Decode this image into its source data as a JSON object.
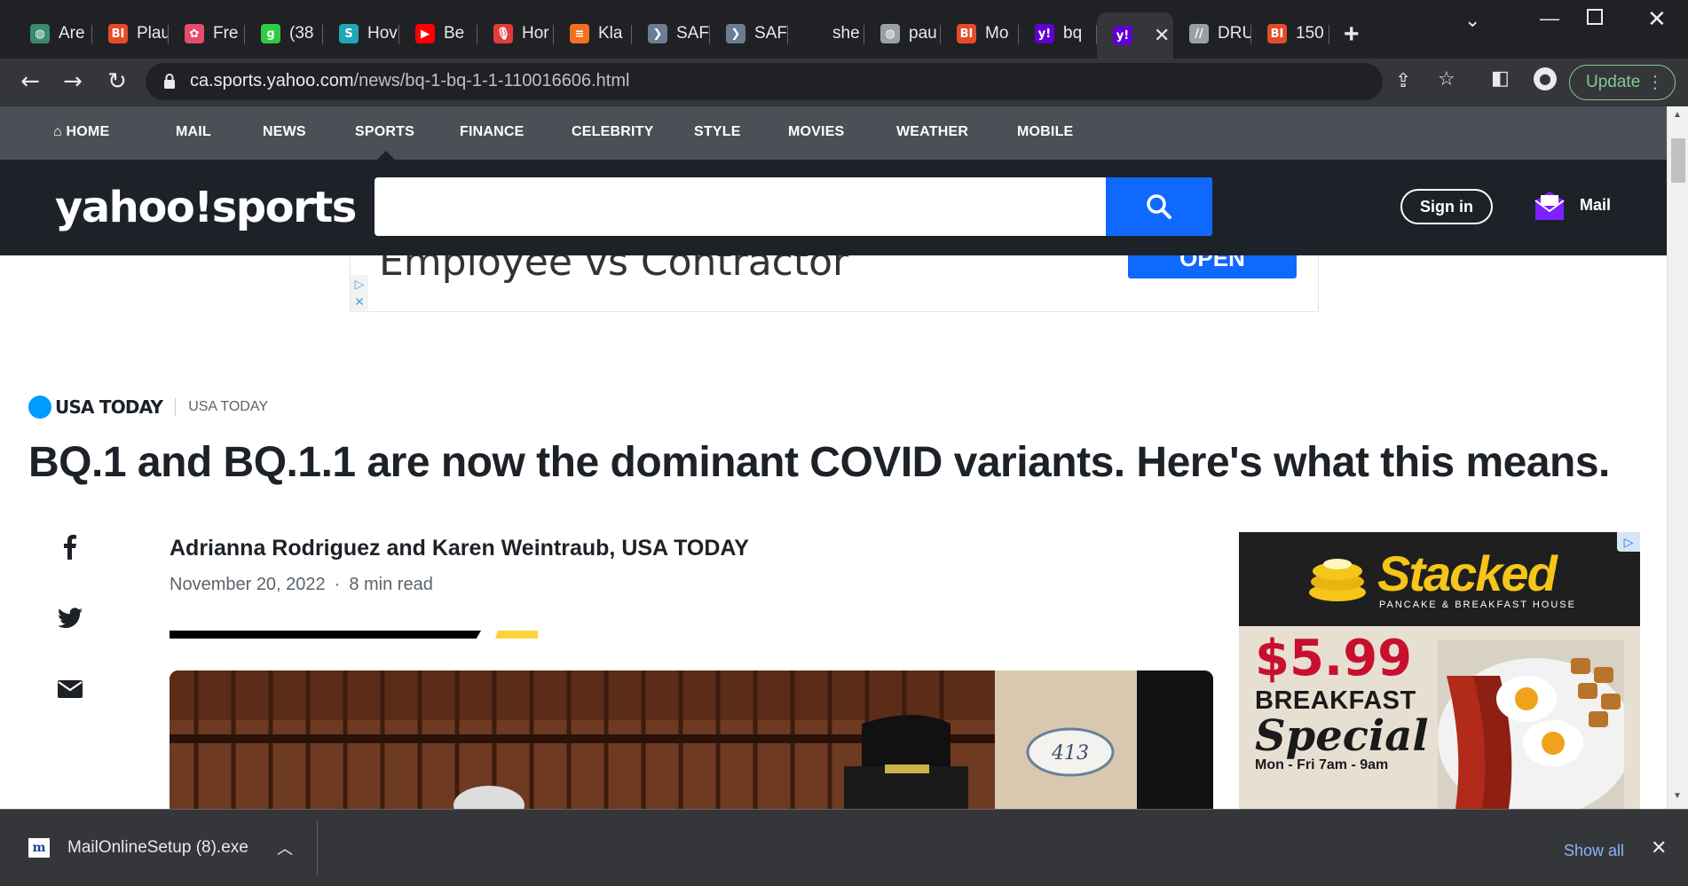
{
  "browser": {
    "tabs": [
      {
        "title": "Are",
        "icon": "globe-icon",
        "color": "#3c8a6e"
      },
      {
        "title": "Plau",
        "icon": "bi-logo-icon",
        "color": "#e54b28"
      },
      {
        "title": "Fre",
        "icon": "flower-icon",
        "color": "#e74c6f"
      },
      {
        "title": "(38",
        "icon": "g-logo-icon",
        "color": "#2ecc40"
      },
      {
        "title": "Hov",
        "icon": "stat-logo-icon",
        "color": "#21a6b5"
      },
      {
        "title": "Be",
        "icon": "youtube-icon",
        "color": "#ff0000"
      },
      {
        "title": "Hor",
        "icon": "mic-icon",
        "color": "#e33b3b"
      },
      {
        "title": "Kla",
        "icon": "stack-icon",
        "color": "#f36f21"
      },
      {
        "title": "SAF",
        "icon": "chevron-logo-icon",
        "color": "#6b7c93"
      },
      {
        "title": "SAF",
        "icon": "chevron-logo-icon",
        "color": "#6b7c93"
      },
      {
        "title": "she",
        "icon": "none",
        "color": "#202124"
      },
      {
        "title": "pau",
        "icon": "globe-icon",
        "color": "#9aa0a6"
      },
      {
        "title": "Mo",
        "icon": "bi-logo-icon",
        "color": "#e54b28"
      },
      {
        "title": "bq",
        "icon": "yahoo-icon",
        "color": "#6001d2"
      },
      {
        "title": "",
        "icon": "yahoo-icon",
        "color": "#6001d2",
        "active": true
      },
      {
        "title": "DRU",
        "icon": "dru-icon",
        "color": "#9aa0a6"
      },
      {
        "title": "150",
        "icon": "bi-logo-icon",
        "color": "#e54b28"
      }
    ],
    "new_tab_label": "+",
    "address": {
      "domain": "ca.sports.yahoo.com",
      "path": "/news/bq-1-bq-1-1-110016606.html"
    },
    "update_label": "Update"
  },
  "yahoo": {
    "nav": [
      "HOME",
      "MAIL",
      "NEWS",
      "SPORTS",
      "FINANCE",
      "CELEBRITY",
      "STYLE",
      "MOVIES",
      "WEATHER",
      "MOBILE"
    ],
    "logo": "yahoo!sports",
    "search_placeholder": "",
    "signin_label": "Sign in",
    "mail_label": "Mail"
  },
  "ad_banner": {
    "text": "Employee vs Contractor",
    "button": "OPEN"
  },
  "article": {
    "provider_logo": "USA TODAY",
    "provider_name": "USA TODAY",
    "headline": "BQ.1 and BQ.1.1 are now the dominant COVID variants. Here's what this means.",
    "byline": "Adrianna Rodriguez and Karen Weintraub, USA TODAY",
    "date": "November 20, 2022",
    "read_time": "8 min read",
    "image_house_number": "413"
  },
  "side_ad": {
    "brand": "Stacked",
    "brand_sub": "PANCAKE & BREAKFAST HOUSE",
    "price": "$5.99",
    "line1": "BREAKFAST",
    "line2": "Special",
    "hours": "Mon - Fri 7am - 9am"
  },
  "download": {
    "filename": "MailOnlineSetup (8).exe",
    "show_all": "Show all"
  }
}
